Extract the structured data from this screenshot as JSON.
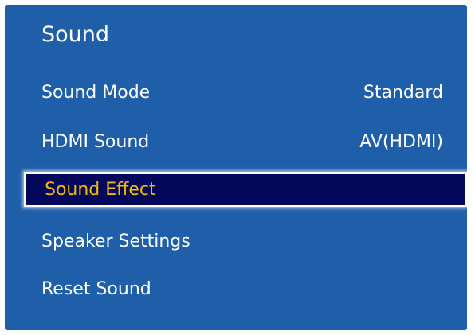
{
  "menu": {
    "title": "Sound",
    "items": [
      {
        "label": "Sound Mode",
        "value": "Standard",
        "selected": false
      },
      {
        "label": "HDMI Sound",
        "value": "AV(HDMI)",
        "selected": false
      },
      {
        "label": "Sound Effect",
        "value": "",
        "selected": true
      },
      {
        "label": "Speaker Settings",
        "value": "",
        "selected": false
      },
      {
        "label": "Reset Sound",
        "value": "",
        "selected": false
      }
    ]
  },
  "colors": {
    "panel_background": "#1f5ea8",
    "selected_background": "#04085a",
    "selected_text": "#f5b800",
    "text": "#ffffff"
  }
}
